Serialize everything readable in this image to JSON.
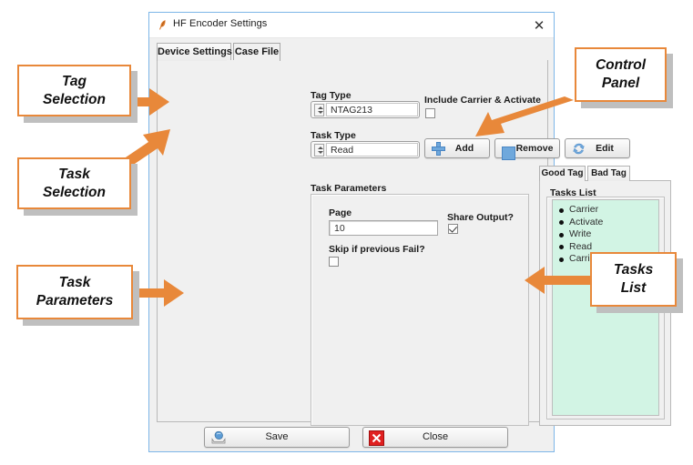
{
  "window": {
    "title": "HF Encoder Settings",
    "icon": "feather-icon",
    "close_label": "✕"
  },
  "tabs": [
    {
      "label": "Device Settings",
      "active": false
    },
    {
      "label": "Case File",
      "active": true
    }
  ],
  "case_file": {
    "tag_type": {
      "label": "Tag Type",
      "value": "NTAG213"
    },
    "include_carrier": {
      "label": "Include Carrier & Activate",
      "checked": false
    },
    "task_type": {
      "label": "Task Type",
      "value": "Read"
    },
    "actions": [
      {
        "label": "Add",
        "icon": "plus-icon"
      },
      {
        "label": "Remove",
        "icon": "minus-icon"
      },
      {
        "label": "Edit",
        "icon": "refresh-icon"
      }
    ],
    "task_parameters": {
      "legend": "Task Parameters",
      "page": {
        "label": "Page",
        "value": "10"
      },
      "share_output": {
        "label": "Share Output?",
        "checked": true
      },
      "skip_if_fail": {
        "label": "Skip if previous Fail?",
        "checked": false
      }
    },
    "tag_tabs": [
      {
        "label": "Good Tag",
        "active": true
      },
      {
        "label": "Bad Tag",
        "active": false
      }
    ],
    "tasks_list": {
      "legend": "Tasks List",
      "background_color": "#d2f4e4",
      "items": [
        "Carrier",
        "Activate",
        "Write",
        "Read",
        "Carrier"
      ]
    }
  },
  "footer": {
    "save": {
      "label": "Save",
      "icon": "save-disk-icon"
    },
    "close": {
      "label": "Close",
      "icon": "red-x-icon"
    }
  },
  "annotations": {
    "accent_color": "#e8883a",
    "items": [
      {
        "id": "tag-selection",
        "line1": "Tag",
        "line2": "Selection"
      },
      {
        "id": "task-selection",
        "line1": "Task",
        "line2": "Selection"
      },
      {
        "id": "task-parameters",
        "line1": "Task",
        "line2": "Parameters"
      },
      {
        "id": "control-panel",
        "line1": "Control",
        "line2": "Panel"
      },
      {
        "id": "tasks-list",
        "line1": "Tasks",
        "line2": "List"
      }
    ]
  }
}
